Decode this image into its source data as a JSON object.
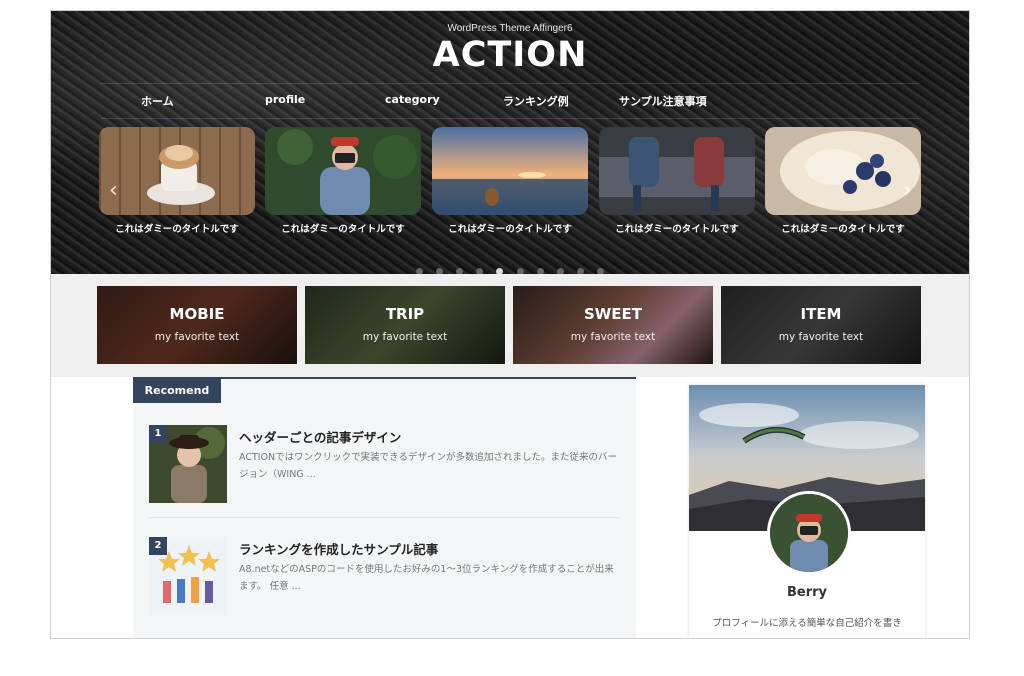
{
  "header": {
    "subtitle": "WordPress Theme Affinger6",
    "logo": "ACTION"
  },
  "nav": {
    "items": [
      "ホーム",
      "profile",
      "category",
      "ランキング例",
      "サンプル注意事項"
    ]
  },
  "slider": {
    "slides": [
      {
        "title": "これはダミーのタイトルです"
      },
      {
        "title": "これはダミーのタイトルです"
      },
      {
        "title": "これはダミーのタイトルです"
      },
      {
        "title": "これはダミーのタイトルです"
      },
      {
        "title": "これはダミーのタイトルです"
      }
    ],
    "prev_icon": "‹",
    "next_icon": "›",
    "dot_count": 10,
    "active_dot": 4
  },
  "categories": [
    {
      "title": "MOBIE",
      "sub": "my favorite text"
    },
    {
      "title": "TRIP",
      "sub": "my favorite text"
    },
    {
      "title": "SWEET",
      "sub": "my favorite text"
    },
    {
      "title": "ITEM",
      "sub": "my favorite text"
    }
  ],
  "recomend": {
    "label": "Recomend",
    "items": [
      {
        "num": "1",
        "title": "ヘッダーごとの記事デザイン",
        "desc": "ACTIONではワンクリックで実装できるデザインが多数追加されました。また従来のバージョン（WING ..."
      },
      {
        "num": "2",
        "title": "ランキングを作成したサンプル記事",
        "desc": "A8.netなどのASPのコードを使用したお好みの1〜3位ランキングを作成することが出来ます。 任意 ..."
      }
    ]
  },
  "profile": {
    "name": "Berry",
    "desc": "プロフィールに添える簡単な自己紹介を書き"
  },
  "colors": {
    "accent": "#34445c",
    "hero_bg": "#1a1a1a"
  }
}
